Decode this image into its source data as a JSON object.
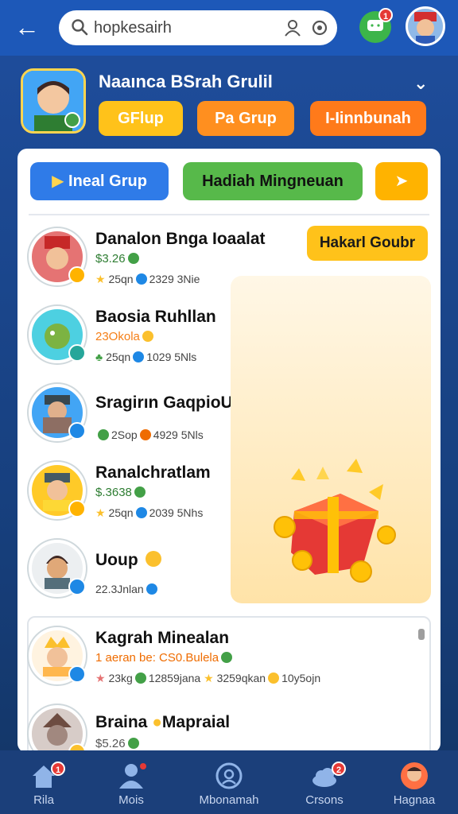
{
  "topbar": {
    "search_value": "hopkesairh",
    "chat_badge": "1"
  },
  "header": {
    "group_title": "Naaınca BSrah Grulil",
    "pills": [
      "GFlup",
      "Pa Grup",
      "I-Iinnbunah"
    ]
  },
  "tabs": {
    "group_tab": "Ineal Grup",
    "weekly_gift": "Hadiah Mingneuan"
  },
  "help_button": "Hakarl Goubr",
  "members": [
    {
      "name": "Danalon Bnga Ioaalat",
      "coins": "$3.26",
      "stat1": "25qn",
      "stat2": "2329 3Nie"
    },
    {
      "name": "Baosia Ruhllan",
      "coins": "23Okola",
      "stat1": "25qn",
      "stat2": "1029 5Nls"
    },
    {
      "name": "Sragirın GaqpioUak",
      "coins": "",
      "stat1": "2Sop",
      "stat2": "4929 5Nls"
    },
    {
      "name": "Ranalchratlam",
      "coins": "$.3638",
      "stat1": "25qn",
      "stat2": "2039 5Nhs"
    },
    {
      "name": "Uoup",
      "coins": "",
      "stat1": "22.3Jnlan",
      "stat2": ""
    }
  ],
  "sub_members": [
    {
      "name": "Kagrah Minealan",
      "coins": "1 aeran be: CS0.Bulela",
      "stat1": "23kg",
      "stat2": "12859jana",
      "stat3": "3259qkan",
      "stat4": "10y5ojn"
    },
    {
      "name": "Braina",
      "name2": "Mapraial",
      "coins": "$5.26"
    }
  ],
  "nav": [
    {
      "label": "Rila",
      "badge": "1"
    },
    {
      "label": "Mois",
      "badge": ""
    },
    {
      "label": "Mbonamah",
      "badge": ""
    },
    {
      "label": "Crsons",
      "badge": "2"
    },
    {
      "label": "Hagnaa",
      "badge": ""
    }
  ],
  "colors": {
    "topbar": "#1d58b8",
    "accent_yellow": "#ffc21a",
    "accent_orange": "#ff8f1f",
    "accent_green": "#57b94a",
    "accent_blue": "#2f7be8"
  }
}
